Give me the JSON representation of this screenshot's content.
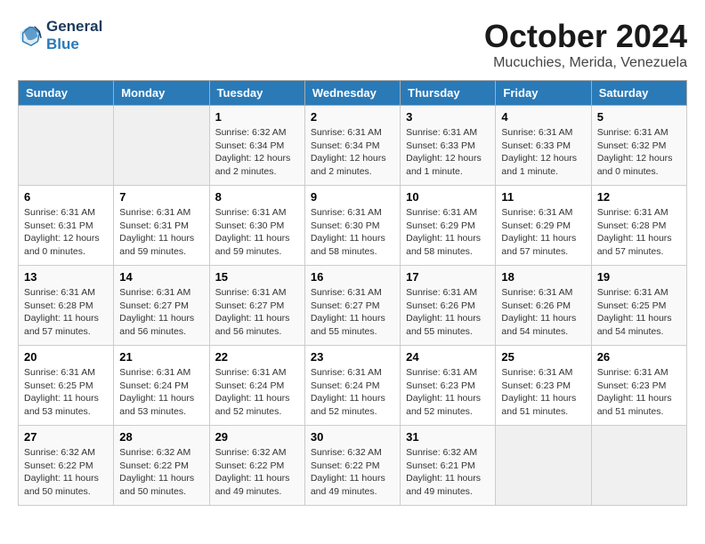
{
  "header": {
    "logo_line1": "General",
    "logo_line2": "Blue",
    "month": "October 2024",
    "location": "Mucuchies, Merida, Venezuela"
  },
  "weekdays": [
    "Sunday",
    "Monday",
    "Tuesday",
    "Wednesday",
    "Thursday",
    "Friday",
    "Saturday"
  ],
  "weeks": [
    [
      {
        "day": "",
        "info": ""
      },
      {
        "day": "",
        "info": ""
      },
      {
        "day": "1",
        "info": "Sunrise: 6:32 AM\nSunset: 6:34 PM\nDaylight: 12 hours\nand 2 minutes."
      },
      {
        "day": "2",
        "info": "Sunrise: 6:31 AM\nSunset: 6:34 PM\nDaylight: 12 hours\nand 2 minutes."
      },
      {
        "day": "3",
        "info": "Sunrise: 6:31 AM\nSunset: 6:33 PM\nDaylight: 12 hours\nand 1 minute."
      },
      {
        "day": "4",
        "info": "Sunrise: 6:31 AM\nSunset: 6:33 PM\nDaylight: 12 hours\nand 1 minute."
      },
      {
        "day": "5",
        "info": "Sunrise: 6:31 AM\nSunset: 6:32 PM\nDaylight: 12 hours\nand 0 minutes."
      }
    ],
    [
      {
        "day": "6",
        "info": "Sunrise: 6:31 AM\nSunset: 6:31 PM\nDaylight: 12 hours\nand 0 minutes."
      },
      {
        "day": "7",
        "info": "Sunrise: 6:31 AM\nSunset: 6:31 PM\nDaylight: 11 hours\nand 59 minutes."
      },
      {
        "day": "8",
        "info": "Sunrise: 6:31 AM\nSunset: 6:30 PM\nDaylight: 11 hours\nand 59 minutes."
      },
      {
        "day": "9",
        "info": "Sunrise: 6:31 AM\nSunset: 6:30 PM\nDaylight: 11 hours\nand 58 minutes."
      },
      {
        "day": "10",
        "info": "Sunrise: 6:31 AM\nSunset: 6:29 PM\nDaylight: 11 hours\nand 58 minutes."
      },
      {
        "day": "11",
        "info": "Sunrise: 6:31 AM\nSunset: 6:29 PM\nDaylight: 11 hours\nand 57 minutes."
      },
      {
        "day": "12",
        "info": "Sunrise: 6:31 AM\nSunset: 6:28 PM\nDaylight: 11 hours\nand 57 minutes."
      }
    ],
    [
      {
        "day": "13",
        "info": "Sunrise: 6:31 AM\nSunset: 6:28 PM\nDaylight: 11 hours\nand 57 minutes."
      },
      {
        "day": "14",
        "info": "Sunrise: 6:31 AM\nSunset: 6:27 PM\nDaylight: 11 hours\nand 56 minutes."
      },
      {
        "day": "15",
        "info": "Sunrise: 6:31 AM\nSunset: 6:27 PM\nDaylight: 11 hours\nand 56 minutes."
      },
      {
        "day": "16",
        "info": "Sunrise: 6:31 AM\nSunset: 6:27 PM\nDaylight: 11 hours\nand 55 minutes."
      },
      {
        "day": "17",
        "info": "Sunrise: 6:31 AM\nSunset: 6:26 PM\nDaylight: 11 hours\nand 55 minutes."
      },
      {
        "day": "18",
        "info": "Sunrise: 6:31 AM\nSunset: 6:26 PM\nDaylight: 11 hours\nand 54 minutes."
      },
      {
        "day": "19",
        "info": "Sunrise: 6:31 AM\nSunset: 6:25 PM\nDaylight: 11 hours\nand 54 minutes."
      }
    ],
    [
      {
        "day": "20",
        "info": "Sunrise: 6:31 AM\nSunset: 6:25 PM\nDaylight: 11 hours\nand 53 minutes."
      },
      {
        "day": "21",
        "info": "Sunrise: 6:31 AM\nSunset: 6:24 PM\nDaylight: 11 hours\nand 53 minutes."
      },
      {
        "day": "22",
        "info": "Sunrise: 6:31 AM\nSunset: 6:24 PM\nDaylight: 11 hours\nand 52 minutes."
      },
      {
        "day": "23",
        "info": "Sunrise: 6:31 AM\nSunset: 6:24 PM\nDaylight: 11 hours\nand 52 minutes."
      },
      {
        "day": "24",
        "info": "Sunrise: 6:31 AM\nSunset: 6:23 PM\nDaylight: 11 hours\nand 52 minutes."
      },
      {
        "day": "25",
        "info": "Sunrise: 6:31 AM\nSunset: 6:23 PM\nDaylight: 11 hours\nand 51 minutes."
      },
      {
        "day": "26",
        "info": "Sunrise: 6:31 AM\nSunset: 6:23 PM\nDaylight: 11 hours\nand 51 minutes."
      }
    ],
    [
      {
        "day": "27",
        "info": "Sunrise: 6:32 AM\nSunset: 6:22 PM\nDaylight: 11 hours\nand 50 minutes."
      },
      {
        "day": "28",
        "info": "Sunrise: 6:32 AM\nSunset: 6:22 PM\nDaylight: 11 hours\nand 50 minutes."
      },
      {
        "day": "29",
        "info": "Sunrise: 6:32 AM\nSunset: 6:22 PM\nDaylight: 11 hours\nand 49 minutes."
      },
      {
        "day": "30",
        "info": "Sunrise: 6:32 AM\nSunset: 6:22 PM\nDaylight: 11 hours\nand 49 minutes."
      },
      {
        "day": "31",
        "info": "Sunrise: 6:32 AM\nSunset: 6:21 PM\nDaylight: 11 hours\nand 49 minutes."
      },
      {
        "day": "",
        "info": ""
      },
      {
        "day": "",
        "info": ""
      }
    ]
  ]
}
